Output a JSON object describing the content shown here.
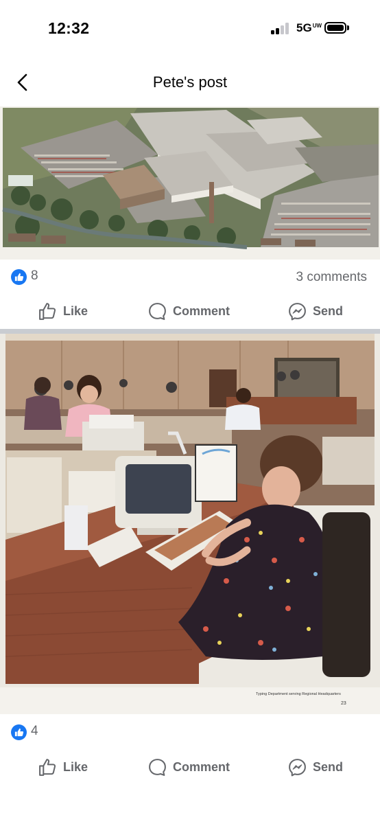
{
  "status_bar": {
    "time": "12:32",
    "network": "5G",
    "network_suffix": "UW"
  },
  "header": {
    "title": "Pete's post",
    "back_icon": "chevron-left-icon"
  },
  "posts": [
    {
      "photo_description": "aerial-view-of-office-complex-and-car-park",
      "photo_caption": "",
      "page_number": "",
      "reaction_count": "8",
      "comments_label": "3 comments",
      "actions": {
        "like": "Like",
        "comment": "Comment",
        "send": "Send"
      }
    },
    {
      "photo_description": "typing-department-office-interior",
      "photo_caption": "Typing Department serving Regional Headquarters",
      "page_number": "23",
      "reaction_count": "4",
      "comments_label": "",
      "actions": {
        "like": "Like",
        "comment": "Comment",
        "send": "Send"
      }
    }
  ],
  "colors": {
    "facebook_blue": "#1877f2",
    "secondary_text": "#65676b",
    "separator": "#c9ccd1"
  }
}
